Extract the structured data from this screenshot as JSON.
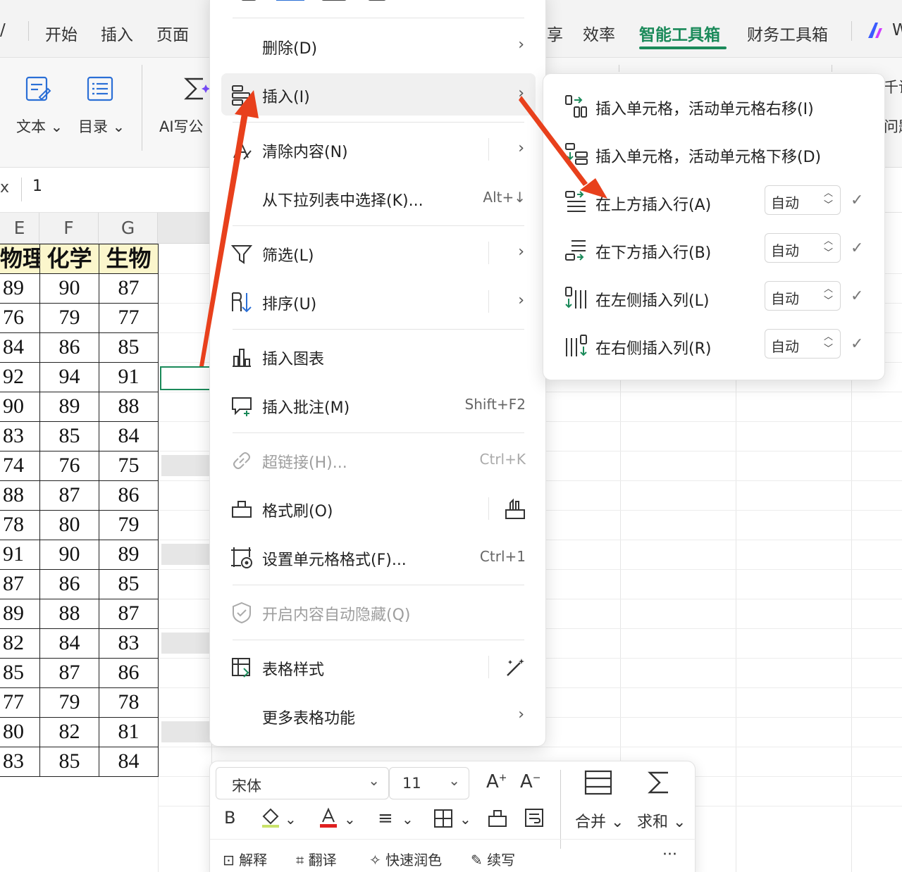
{
  "ribbon": {
    "tabs": [
      "开始",
      "插入",
      "页面",
      "享",
      "效率",
      "智能工具箱",
      "财务工具箱"
    ],
    "active_tab": "智能工具箱",
    "tab_partial_right": "W",
    "left_partial": "/",
    "buttons": {
      "text": "文本",
      "toc": "目录",
      "ai_formula": "AI写公",
      "right_partial_1": "千读",
      "right_partial_2": "问题"
    }
  },
  "formula_bar": {
    "fx_partial": "x",
    "value": "1"
  },
  "sheet": {
    "columns": [
      "E",
      "F",
      "G"
    ],
    "header_row": [
      "物理",
      "化学",
      "生物"
    ],
    "rows": [
      [
        "89",
        "90",
        "87"
      ],
      [
        "76",
        "79",
        "77"
      ],
      [
        "84",
        "86",
        "85"
      ],
      [
        "92",
        "94",
        "91"
      ],
      [
        "90",
        "89",
        "88"
      ],
      [
        "83",
        "85",
        "84"
      ],
      [
        "74",
        "76",
        "75"
      ],
      [
        "88",
        "87",
        "86"
      ],
      [
        "78",
        "80",
        "79"
      ],
      [
        "91",
        "90",
        "89"
      ],
      [
        "87",
        "86",
        "85"
      ],
      [
        "89",
        "88",
        "87"
      ],
      [
        "82",
        "84",
        "83"
      ],
      [
        "85",
        "87",
        "86"
      ],
      [
        "77",
        "79",
        "78"
      ],
      [
        "80",
        "82",
        "81"
      ],
      [
        "83",
        "85",
        "84"
      ]
    ]
  },
  "context_menu": {
    "items": [
      {
        "label": "删除(D)",
        "chevron": "›"
      },
      {
        "label": "插入(I)",
        "chevron": "›"
      },
      {
        "label": "清除内容(N)",
        "chevron": "›"
      },
      {
        "label": "从下拉列表中选择(K)...",
        "shortcut": "Alt+↓"
      },
      {
        "label": "筛选(L)",
        "chevron": "›"
      },
      {
        "label": "排序(U)",
        "chevron": "›"
      },
      {
        "label": "插入图表"
      },
      {
        "label": "插入批注(M)",
        "shortcut": "Shift+F2"
      },
      {
        "label": "超链接(H)...",
        "shortcut": "Ctrl+K"
      },
      {
        "label": "格式刷(O)"
      },
      {
        "label": "设置单元格格式(F)...",
        "shortcut": "Ctrl+1"
      },
      {
        "label": "开启内容自动隐藏(Q)"
      },
      {
        "label": "表格样式"
      },
      {
        "label": "更多表格功能",
        "chevron": "›"
      }
    ]
  },
  "submenu": {
    "items": [
      {
        "label": "插入单元格，活动单元格右移(I)"
      },
      {
        "label": "插入单元格，活动单元格下移(D)"
      },
      {
        "label": "在上方插入行(A)",
        "value": "自动",
        "check": "✓"
      },
      {
        "label": "在下方插入行(B)",
        "value": "自动",
        "check": "✓"
      },
      {
        "label": "在左侧插入列(L)",
        "value": "自动",
        "check": "✓"
      },
      {
        "label": "在右侧插入列(R)",
        "value": "自动",
        "check": "✓"
      }
    ]
  },
  "mini_toolbar": {
    "font_name": "宋体",
    "font_size": "11",
    "bold": "B",
    "merge": "合并",
    "sum": "求和",
    "explain": "解释",
    "translate": "翻译",
    "polish": "快速润色",
    "continue": "续写",
    "more": "···"
  },
  "colors": {
    "accent": "#1b8a5a",
    "arrow": "#e8401c",
    "header_fill": "#fbf6cc"
  }
}
